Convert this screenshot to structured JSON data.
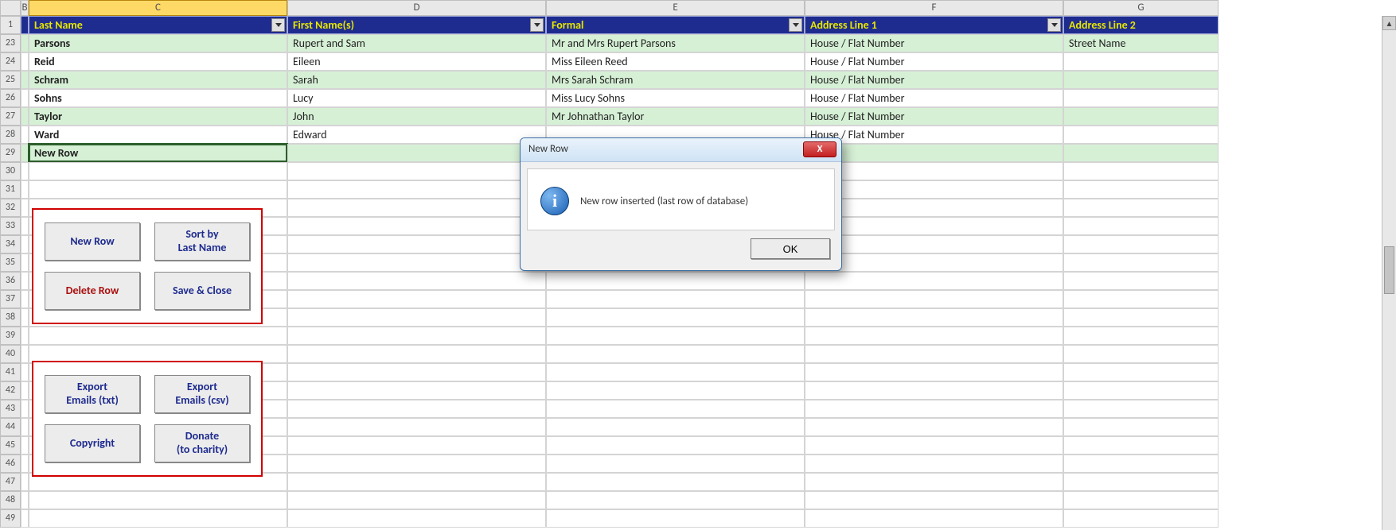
{
  "columns": {
    "letters": [
      "",
      "B",
      "C",
      "D",
      "E",
      "F",
      "G"
    ],
    "headers": [
      "Last Name",
      "First Name(s)",
      "Formal",
      "Address Line 1",
      "Address Line 2"
    ]
  },
  "row_numbers_header": "1",
  "data_row_numbers": [
    "23",
    "24",
    "25",
    "26",
    "27",
    "28",
    "29"
  ],
  "rows": [
    {
      "last": "Parsons",
      "first": "Rupert and Sam",
      "formal": "Mr and Mrs Rupert Parsons",
      "addr1": "House / Flat Number",
      "addr2": "Street Name"
    },
    {
      "last": "Reid",
      "first": "Eileen",
      "formal": "Miss Eileen Reed",
      "addr1": "House / Flat Number",
      "addr2": ""
    },
    {
      "last": "Schram",
      "first": "Sarah",
      "formal": "Mrs Sarah Schram",
      "addr1": "House / Flat Number",
      "addr2": ""
    },
    {
      "last": "Sohns",
      "first": "Lucy",
      "formal": "Miss Lucy Sohns",
      "addr1": "House / Flat Number",
      "addr2": ""
    },
    {
      "last": "Taylor",
      "first": "John",
      "formal": "Mr Johnathan Taylor",
      "addr1": "House / Flat Number",
      "addr2": ""
    },
    {
      "last": "Ward",
      "first": "Edward",
      "formal": "",
      "addr1": "House / Flat Number",
      "addr2": ""
    },
    {
      "last": "New Row",
      "first": "",
      "formal": "",
      "addr1": "",
      "addr2": ""
    }
  ],
  "trailing_row_numbers": [
    "30",
    "31",
    "32",
    "33",
    "34",
    "35",
    "36",
    "37",
    "38",
    "39",
    "40",
    "41",
    "42",
    "43",
    "44",
    "45",
    "46",
    "47",
    "48",
    "49"
  ],
  "buttons_group1": {
    "new_row": "New Row",
    "sort_last": "Sort by\nLast Name",
    "delete_row": "Delete Row",
    "save_close": "Save & Close"
  },
  "buttons_group2": {
    "export_txt": "Export\nEmails (txt)",
    "export_csv": "Export\nEmails (csv)",
    "copyright": "Copyright",
    "donate": "Donate\n(to charity)"
  },
  "dialog": {
    "title": "New Row",
    "message": "New row inserted (last row of database)",
    "ok": "OK",
    "close": "X"
  }
}
